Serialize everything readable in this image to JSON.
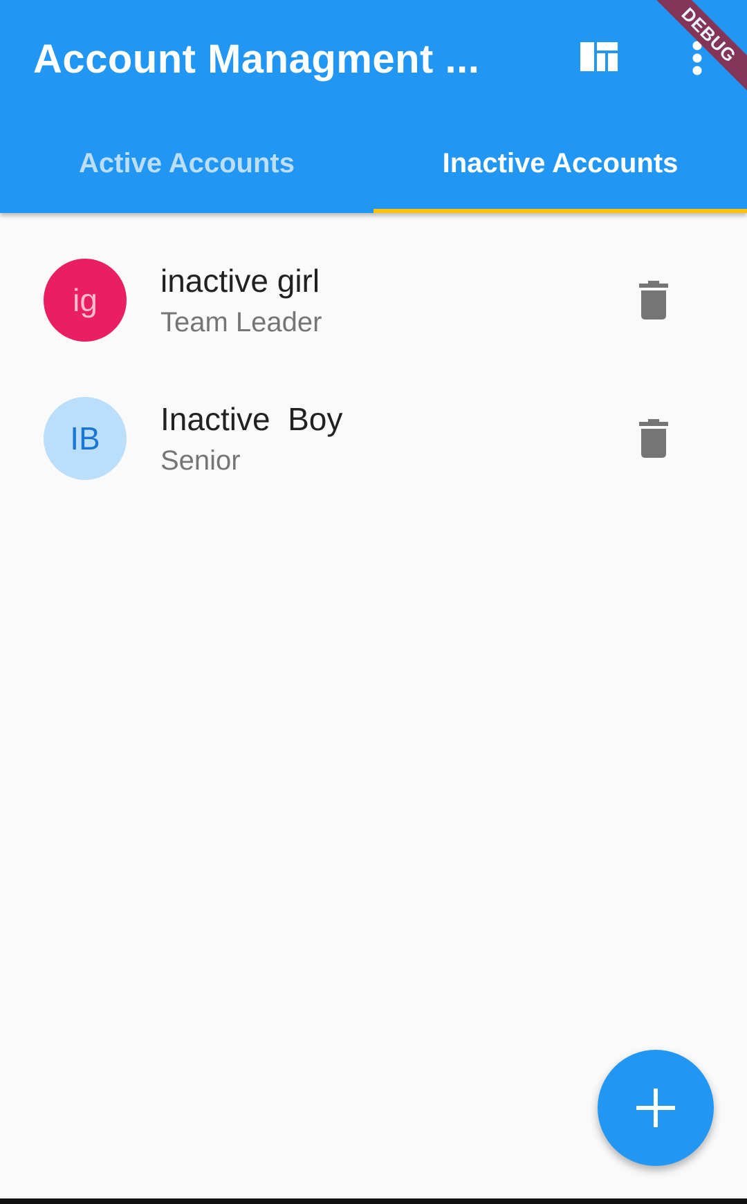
{
  "appbar": {
    "title": "Account Managment ...",
    "background_color": "#2196F3",
    "actions": [
      {
        "icon": "dashboard-icon"
      },
      {
        "icon": "more-vert-icon"
      }
    ],
    "debug_banner": "DEBUG"
  },
  "tabs": {
    "items": [
      {
        "label": "Active Accounts",
        "selected": false
      },
      {
        "label": "Inactive Accounts",
        "selected": true
      }
    ],
    "indicator_color": "#FFC107"
  },
  "accounts": [
    {
      "initials": "ig",
      "name": "inactive girl",
      "role": "Team Leader",
      "avatar_bg": "#E91E63",
      "avatar_fg": "#F8BBD0",
      "action_icon": "delete-icon"
    },
    {
      "initials": "IB",
      "name": "Inactive  Boy",
      "role": "Senior",
      "avatar_bg": "#BBDEFB",
      "avatar_fg": "#1976D2",
      "action_icon": "delete-icon"
    }
  ],
  "fab": {
    "icon": "add-icon",
    "color": "#2196F3"
  }
}
